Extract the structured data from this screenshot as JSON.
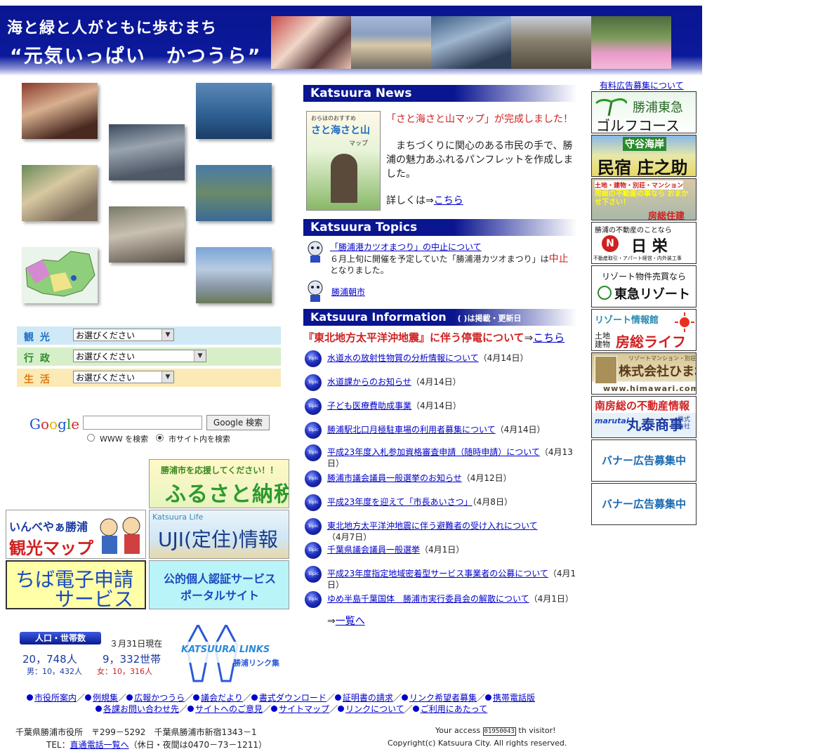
{
  "header": {
    "slogan_line1": "海と緑と人がともに歩むまち",
    "slogan_line2": "“元気いっぱい　かつうら”"
  },
  "categories": [
    {
      "label": "観 光",
      "value": "お選びください",
      "bg": "#cfe9f6",
      "color": "#1b6fc2"
    },
    {
      "label": "行 政",
      "value": "お選びください",
      "bg": "#d6efc8",
      "color": "#2e8b2e"
    },
    {
      "label": "生 活",
      "value": "お選びください",
      "bg": "#fbe9b6",
      "color": "#e07a10"
    }
  ],
  "search": {
    "logo": "Google",
    "button": "Google 検索",
    "option_www": "WWW を検索",
    "option_site": "市サイト内を検索"
  },
  "left_banners": {
    "furusato_top": "勝浦市を応援してください！！",
    "furusato_main": "ふるさと納税",
    "kanko_top": "いんべやぁ勝浦",
    "kanko_main": "観光マップ",
    "uji_top": "Katsuura Life",
    "uji_main": "UJI(定住)情報",
    "chiba_line1": "ちば電子申請",
    "chiba_line2": "サービス",
    "kojin_line1": "公的個人認証サービス",
    "kojin_line2": "ポータルサイト"
  },
  "population": {
    "badge": "人口・世帯数",
    "date": "３月31日現在",
    "people": "20，748人",
    "households": "9，332世帯",
    "male": "男：10，432人",
    "female": "女：10，316人"
  },
  "links_logo": {
    "en": "KATSUURA LINKS",
    "jp": "勝浦リンク集"
  },
  "news": {
    "header": "Katsuura News",
    "title": "「さと海さと山マップ」が完成しました！",
    "body": "　まちづくりに関心のある市民の手で、勝浦の魅力あふれるパンフレットを作成しました。",
    "more_prefix": "詳しくは⇒",
    "more_link": "こちら",
    "cover_top": "おらほのおすすめ",
    "cover_title": "さと海さと山",
    "cover_sub": "マップ"
  },
  "topics": {
    "header": "Katsuura Topics",
    "items": [
      {
        "link": "「勝浦港カツオまつり」の中止について",
        "desc_before": "６月上旬に開催を予定していた「勝浦港カツオまつり」は",
        "desc_highlight": "中止",
        "desc_after": "となりました。"
      },
      {
        "link": "勝浦朝市"
      }
    ]
  },
  "information": {
    "header": "Katsuura Information",
    "header_note": "( )は掲載・更新日",
    "alert_link_text": "『東北地方太平洋沖地震』に伴う停電について",
    "alert_arrow": "⇒",
    "alert_link": "こちら",
    "icon_label": "Topic",
    "items": [
      {
        "link": "水道水の放射性物質の分析情報について",
        "date": "（4月14日）"
      },
      {
        "link": "水道課からのお知らせ",
        "date": "（4月14日）"
      },
      {
        "link": "子ども医療費助成事業",
        "date": "（4月14日）"
      },
      {
        "link": "勝浦駅北口月極駐車場の利用者募集について",
        "date": "（4月14日）"
      },
      {
        "link": "平成23年度入札参加資格審査申請（随時申請）について",
        "date": "（4月13日）"
      },
      {
        "link": "勝浦市議会議員一般選挙のお知らせ",
        "date": "（4月12日）"
      },
      {
        "link": "平成23年度を迎えて「市長あいさつ」",
        "date": "（4月8日）"
      },
      {
        "link": "東北地方太平洋沖地震に伴う避難者の受け入れについて",
        "date": "（4月7日）"
      },
      {
        "link": "千葉県議会議員一般選挙",
        "date": "（4月1日）"
      },
      {
        "link": "平成23年度指定地域密着型サービス事業者の公募について",
        "date": "（4月1日）"
      },
      {
        "link": "ゆめ半島千葉国体　勝浦市実行委員会の解散について",
        "date": "（4月1日）"
      }
    ],
    "list_arrow": "⇒",
    "list_link": "一覧へ"
  },
  "ads": {
    "recruit_link": "有料広告募集について",
    "items": [
      {
        "line1": "勝浦東急",
        "line2": "ゴルフコース"
      },
      {
        "line1": "守谷海岸",
        "line2": "民宿 庄之助"
      },
      {
        "line1": "土地・建物・別荘・マンション",
        "line2": "房総住建",
        "line3": "房総の不動産の事なら おまかせ下さい！"
      },
      {
        "line1": "勝浦の不動産のことなら",
        "line2": "日 栄",
        "line3": "不動産取引・アパート経営・内外装工事"
      },
      {
        "line1": "リゾート物件売買なら",
        "line2": "東急リゾート"
      },
      {
        "line1": "リゾート情報館",
        "line2": "房総ライフ",
        "line3": "土地 建物"
      },
      {
        "line1": "リゾートマンション・別荘",
        "line2": "株式会社ひまわり",
        "line3": "www.himawari.com"
      },
      {
        "line1": "南房総の不動産情報",
        "line2": "丸泰商事",
        "line3": "marutai",
        "line4": "株式会社"
      },
      {
        "line1": "バナー広告募集中"
      },
      {
        "line1": "バナー広告募集中"
      }
    ]
  },
  "footer": {
    "links_row1": [
      "市役所案内",
      "例規集",
      "広報かつうら",
      "議会だより",
      "書式ダウンロード",
      "証明書の請求",
      "リンク希望者募集",
      "携帯電話版"
    ],
    "links_row2": [
      "各課お問い合わせ先",
      "サイトへのご意見",
      "サイトマップ",
      "リンクについて",
      "ご利用にあたって"
    ],
    "separator": "／",
    "address": "千葉県勝浦市役所　〒299－5292　千葉県勝浦市新宿1343－1",
    "tel_prefix": "TEL：",
    "tel_link": "直通電話一覧へ",
    "tel_suffix": "（休日・夜間は0470－73－1211）",
    "access_prefix": "Your access",
    "access_count": "01950043",
    "access_suffix": "th visitor!",
    "copyright": "Copyright(c) Katsuura City. All rights reserved."
  }
}
